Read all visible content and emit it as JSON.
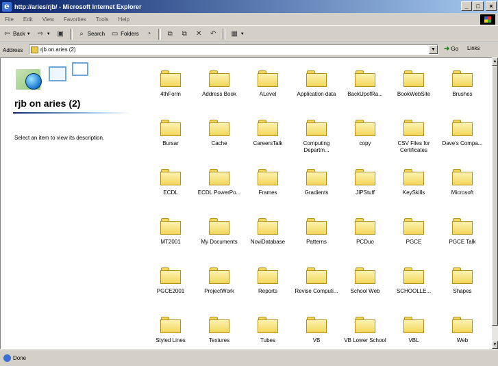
{
  "window": {
    "title": "http://aries/rjb/ - Microsoft Internet Explorer"
  },
  "menu": [
    "File",
    "Edit",
    "View",
    "Favorites",
    "Tools",
    "Help"
  ],
  "toolbar": {
    "back": "Back",
    "search": "Search",
    "folders": "Folders"
  },
  "address": {
    "label": "Address",
    "value": "rjb on aries (2)",
    "go": "Go",
    "links": "Links"
  },
  "leftpane": {
    "title": "rjb on aries (2)",
    "description": "Select an item to view its description."
  },
  "folders": [
    "4thForm",
    "Address Book",
    "ALevel",
    "Application data",
    "BackUpofRa...",
    "BookWebSite",
    "Brushes",
    "Bursar",
    "Cache",
    "CareersTalk",
    "Computing Departm...",
    "copy",
    "CSV Files for Certificates",
    "Dave's Compa...",
    "ECDL",
    "ECDL PowerPo...",
    "Frames",
    "Gradients",
    "JIPStuff",
    "KeySkills",
    "Microsoft",
    "MT2001",
    "My Documents",
    "NoviDatabase",
    "Patterns",
    "PCDuo",
    "PGCE",
    "PGCE Talk",
    "PGCE2001",
    "ProjectWork",
    "Reports",
    "Revise Computi...",
    "School Web",
    "SCHOOLLE...",
    "Shapes",
    "Styled Lines",
    "Textures",
    "Tubes",
    "VB",
    "VB Lower School",
    "VBL",
    "Web"
  ],
  "status": {
    "text": "Done"
  }
}
